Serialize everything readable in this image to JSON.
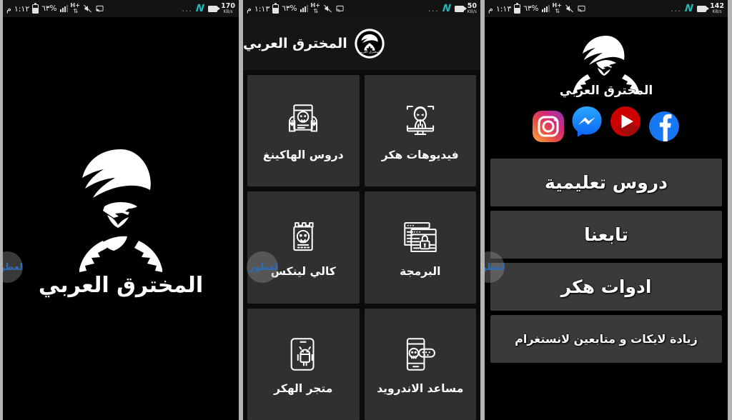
{
  "meta": {
    "app_name": "المخترق العربي",
    "accent_teal": "#1fb6b6",
    "tile_bg": "#303030",
    "button_bg": "#3a3a3a",
    "screen_bg": "#000000",
    "separator": "#b3b3b3"
  },
  "watermark": {
    "text": "العطور"
  },
  "screens": [
    {
      "id": "splash",
      "statusbar": {
        "time": "١:١٢",
        "meridiem": "م",
        "battery_percent": "%٦٣",
        "network_type": "H+",
        "overflow": "...",
        "carrier_logo": "N",
        "speed_value": "170",
        "speed_unit": "KB/s",
        "icons": [
          "battery-icon",
          "signal-bars-icon",
          "hplus-icon",
          "mute-icon",
          "cast-icon",
          "camera-icon"
        ]
      },
      "logo_text": "المخترق العربي"
    },
    {
      "id": "home-grid",
      "statusbar": {
        "time": "١:١٣",
        "meridiem": "م",
        "battery_percent": "%٦٣",
        "network_type": "H+",
        "overflow": "...",
        "carrier_logo": "N",
        "speed_value": "50",
        "speed_unit": "KB/s",
        "icons": [
          "battery-icon",
          "signal-bars-icon",
          "hplus-icon",
          "mute-icon",
          "cast-icon",
          "camera-icon"
        ]
      },
      "appbar": {
        "title": "المخترق العربي",
        "badge": "app-logo-badge-icon"
      },
      "tiles": [
        {
          "label": "فيديوهات هكر",
          "icon": "hacker-at-computer-icon"
        },
        {
          "label": "دروس الهاكينغ",
          "icon": "hands-skull-laptop-icon"
        },
        {
          "label": "البرمجة",
          "icon": "browser-windows-lock-icon"
        },
        {
          "label": "كالي لينكس",
          "icon": "skull-dragon-box-icon"
        },
        {
          "label": "مساعد الاندرويد",
          "icon": "phone-skull-icon"
        },
        {
          "label": "متجر الهكر",
          "icon": "phone-android-icon"
        }
      ]
    },
    {
      "id": "menu",
      "statusbar": {
        "time": "١:١٣",
        "meridiem": "م",
        "battery_percent": "%٦٣",
        "network_type": "H+",
        "overflow": "...",
        "carrier_logo": "N",
        "speed_value": "142",
        "speed_unit": "KB/s",
        "icons": [
          "battery-icon",
          "signal-bars-icon",
          "hplus-icon",
          "mute-icon",
          "cast-icon",
          "camera-icon"
        ]
      },
      "logo_text": "المخترق العربي",
      "socials": [
        {
          "name": "instagram-icon",
          "color": "#d62976"
        },
        {
          "name": "messenger-icon",
          "color": "#0084ff"
        },
        {
          "name": "youtube-icon",
          "color": "#cc0000"
        },
        {
          "name": "facebook-icon",
          "color": "#1877f2"
        }
      ],
      "buttons": [
        {
          "label": "دروس تعليمية",
          "size": "lg"
        },
        {
          "label": "تابعنا",
          "size": "lg"
        },
        {
          "label": "ادوات هكر",
          "size": "lg"
        },
        {
          "label": "زيادة لايكات و متابعين لانستغرام",
          "size": "sm"
        }
      ]
    }
  ]
}
